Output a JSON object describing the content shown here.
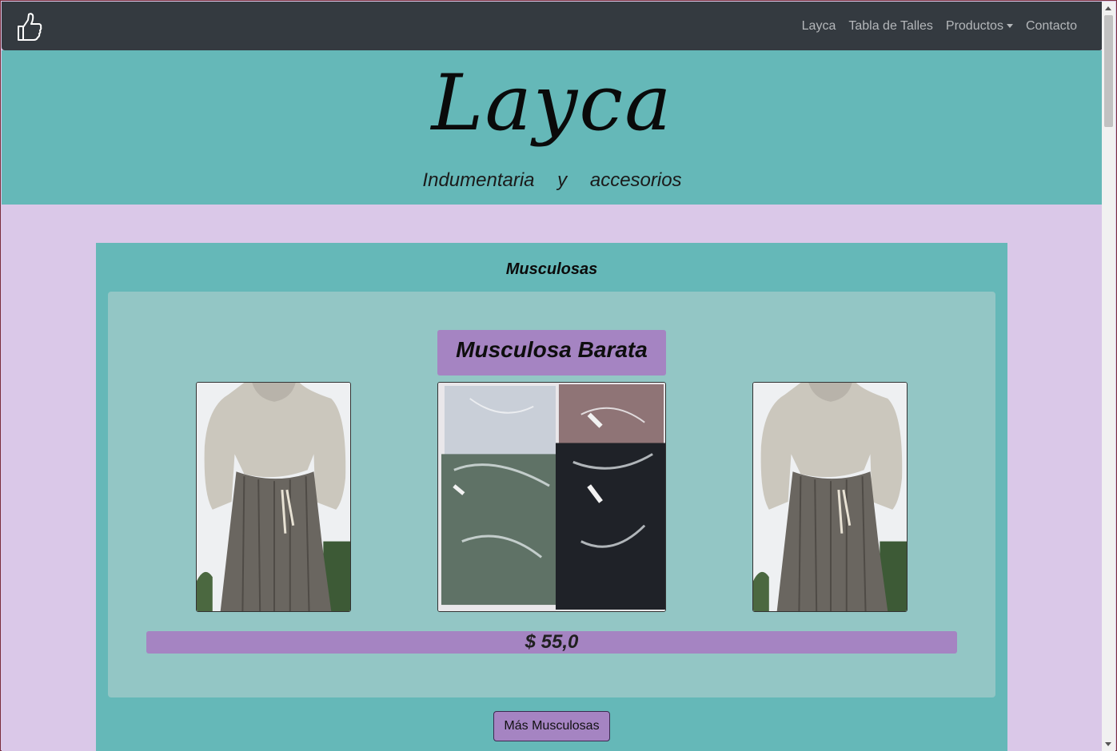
{
  "navbar": {
    "brand_icon": "thumbs-up-icon",
    "links": [
      "Layca",
      "Tabla de Talles",
      "Productos",
      "Contacto"
    ]
  },
  "hero": {
    "logo": "Layca",
    "tagline": "Indumentaria y accesorios"
  },
  "section": {
    "title": "Musculosas",
    "product": {
      "name": "Musculosa Barata",
      "price": "$ 55,0"
    },
    "more_button": "Más Musculosas"
  },
  "colors": {
    "navbar": "#343a40",
    "teal": "#65b8b8",
    "light_teal": "#93c6c5",
    "lilac_bg": "#dac8e8",
    "purple": "#a584c2"
  }
}
